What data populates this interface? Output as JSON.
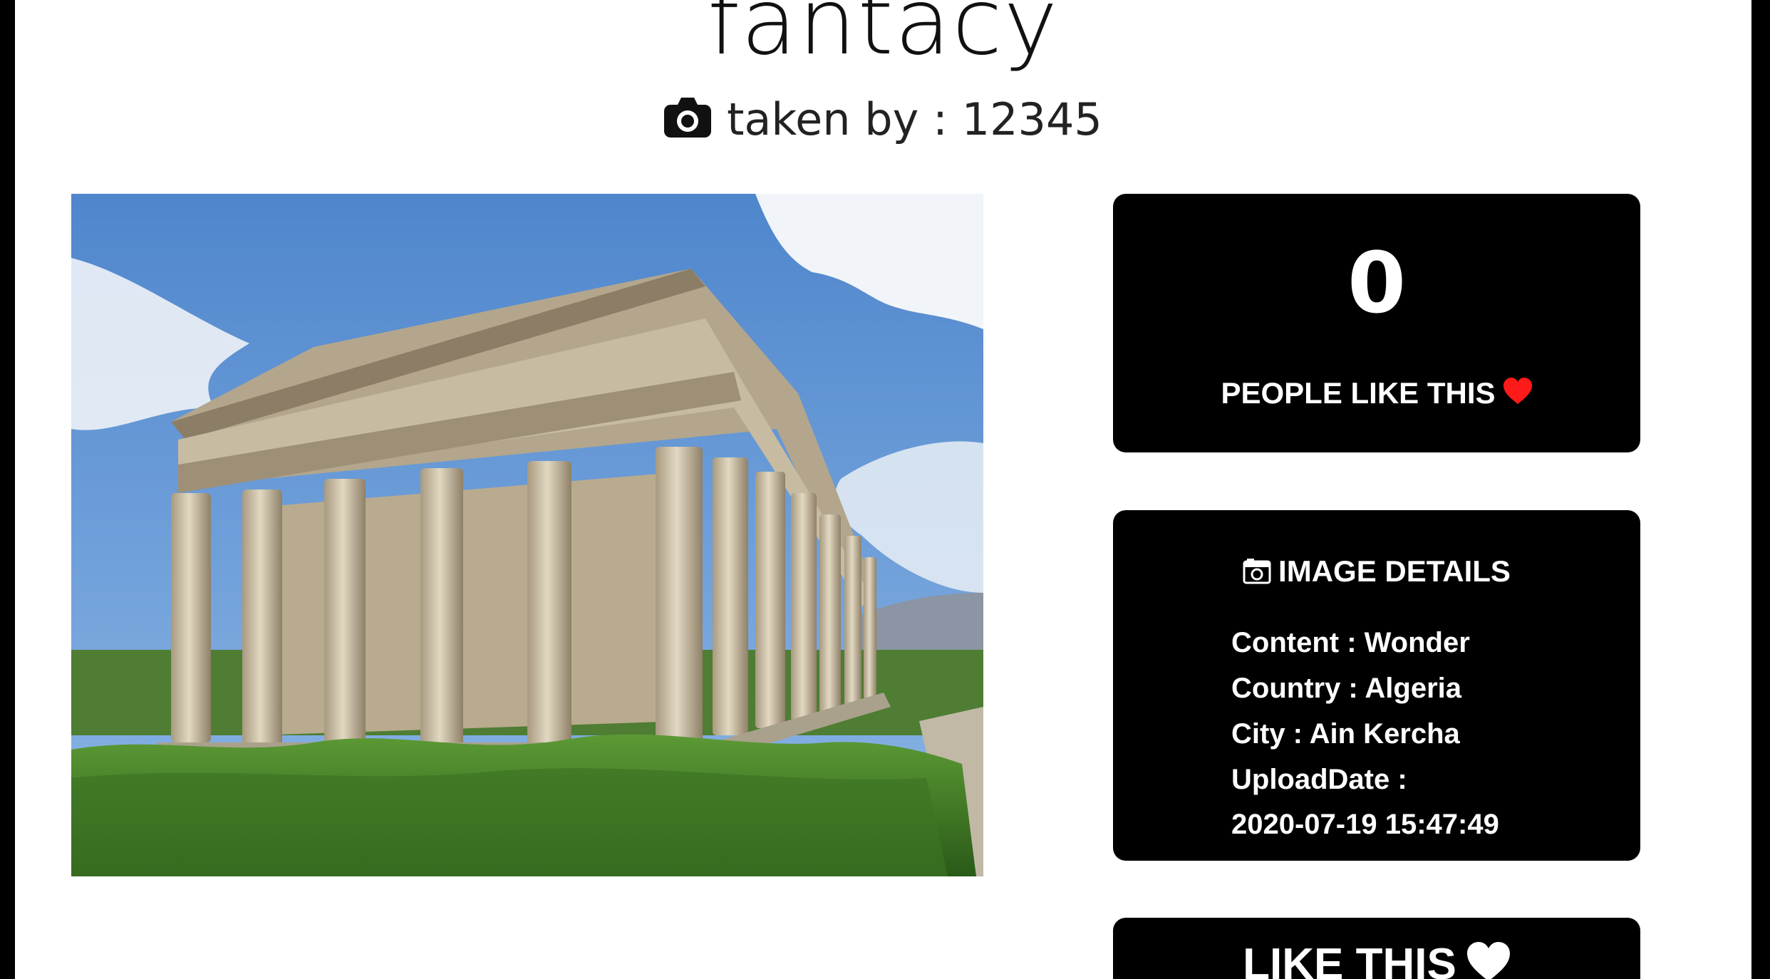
{
  "page": {
    "title": "fantacy",
    "byline": "taken by : 12345"
  },
  "photo": {
    "subject_icon": "temple-photo",
    "description_colors": {
      "sky": "#5b8fd0",
      "stone": "#c9bfa8",
      "shrub": "#3f7a28"
    }
  },
  "likes": {
    "count": "0",
    "label": "PEOPLE LIKE THIS",
    "heart_icon": "heart-icon",
    "heart_color": "#ff1a1a"
  },
  "details": {
    "title": "IMAGE DETAILS",
    "rows": [
      {
        "text": "Content : Wonder"
      },
      {
        "text": "Country : Algeria"
      },
      {
        "text": "City : Ain Kercha"
      },
      {
        "text": "UploadDate :"
      }
    ],
    "upload_date": "2020-07-19 15:47:49"
  },
  "like_button": {
    "label": "LIKE THIS",
    "heart_icon": "heart-icon"
  }
}
